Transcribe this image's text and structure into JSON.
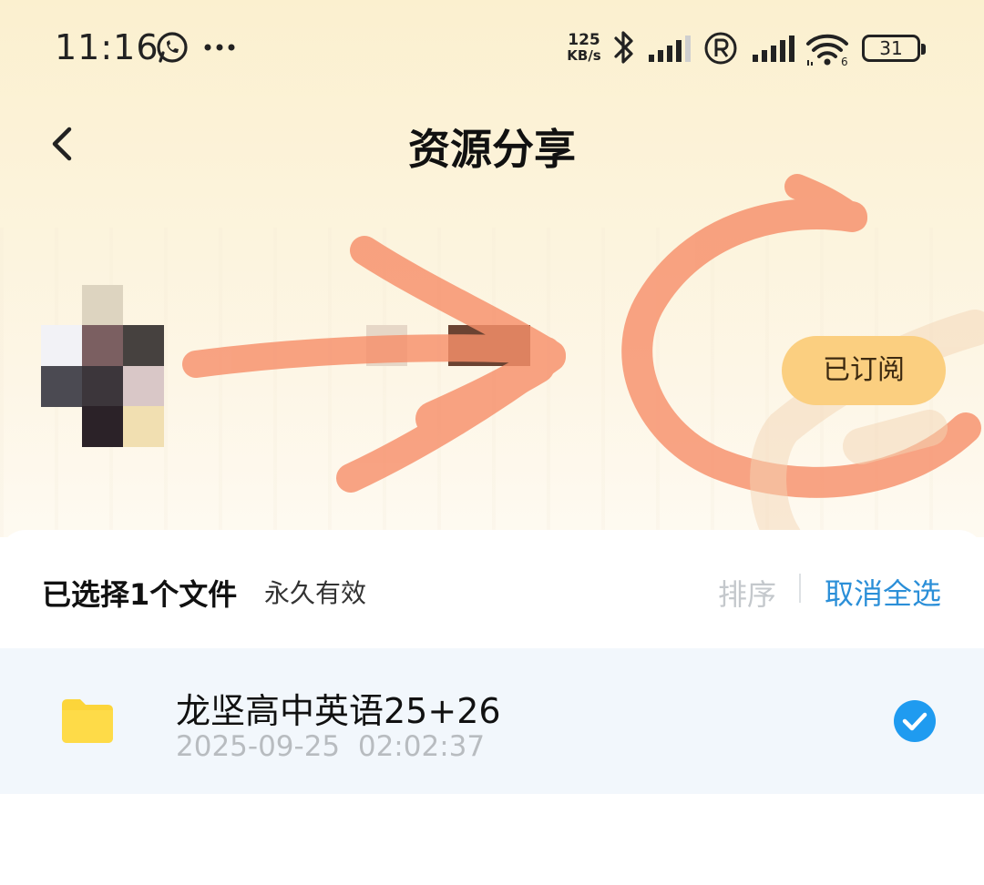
{
  "status_bar": {
    "time": "11:16",
    "net_speed_value": "125",
    "net_speed_unit": "KB/s",
    "battery": "31",
    "icons": [
      "whatsapp-icon",
      "more-dots-icon",
      "bluetooth-icon",
      "signal-icon",
      "roaming-r-icon",
      "signal-icon",
      "wifi-icon",
      "battery-icon"
    ]
  },
  "header": {
    "title": "资源分享"
  },
  "profile": {
    "subscribe_label": "已订阅"
  },
  "toolbar": {
    "selected_text": "已选择1个文件",
    "validity": "永久有效",
    "sort_label": "排序",
    "deselect_label": "取消全选"
  },
  "files": [
    {
      "name": "龙坚高中英语25+26",
      "date": "2025-09-25  02:02:37",
      "icon": "folder-icon",
      "selected": true
    }
  ],
  "colors": {
    "accent_blue": "#2b8fd8",
    "subscribe_bg": "#fbcf80",
    "folder_yellow": "#fdd835",
    "row_selected_bg": "#f2f7fc",
    "annotation_orange": "#f7906b"
  }
}
